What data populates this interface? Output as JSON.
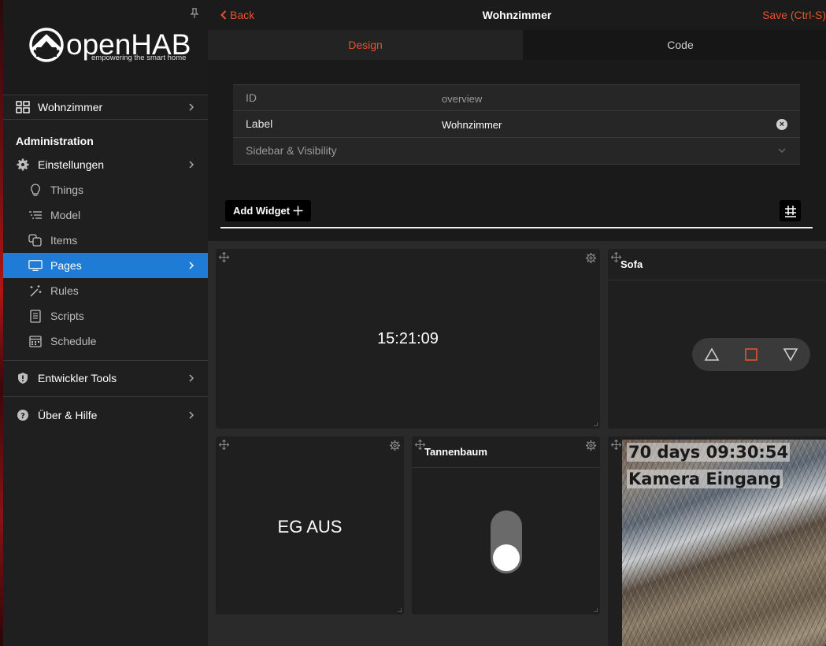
{
  "sidebar": {
    "brand": {
      "name": "openHAB",
      "tagline": "empowering the smart home"
    },
    "current_page": "Wohnzimmer",
    "section_title": "Administration",
    "items": [
      {
        "label": "Einstellungen",
        "icon": "gear-icon",
        "level": 1
      },
      {
        "label": "Things",
        "icon": "lightbulb-icon",
        "level": 2
      },
      {
        "label": "Model",
        "icon": "list-tree-icon",
        "level": 2
      },
      {
        "label": "Items",
        "icon": "squares-icon",
        "level": 2
      },
      {
        "label": "Pages",
        "icon": "monitor-icon",
        "level": 2,
        "active": true
      },
      {
        "label": "Rules",
        "icon": "magic-wand-icon",
        "level": 2
      },
      {
        "label": "Scripts",
        "icon": "document-icon",
        "level": 2
      },
      {
        "label": "Schedule",
        "icon": "calendar-icon",
        "level": 2
      }
    ],
    "dev_tools": "Entwickler Tools",
    "help": "Über & Hilfe"
  },
  "topbar": {
    "back_label": "Back",
    "title": "Wohnzimmer",
    "save_label": "Save (Ctrl-S)"
  },
  "tabs": [
    {
      "label": "Design",
      "active": true
    },
    {
      "label": "Code",
      "active": false
    }
  ],
  "properties": {
    "id_label": "ID",
    "id_value": "overview",
    "label_label": "Label",
    "label_value": "Wohnzimmer",
    "sidebar_visibility": "Sidebar & Visibility"
  },
  "toolbar": {
    "add_widget": "Add Widget"
  },
  "widgets": {
    "clock": {
      "value": "15:21:09"
    },
    "sofa": {
      "title": "Sofa"
    },
    "eg": {
      "value": "EG AUS"
    },
    "tannenbaum": {
      "title": "Tannenbaum",
      "state": "off"
    },
    "camera": {
      "overlay_line1": "70 days 09:30:54",
      "overlay_line2": "Kamera Eingang"
    }
  },
  "colors": {
    "accent": "#e4532f",
    "active_nav": "#1e7bd6",
    "sidebar_bg": "#1f1f1f",
    "card_bg": "#1f1f1f",
    "canvas_bg": "#2a2a2a"
  }
}
